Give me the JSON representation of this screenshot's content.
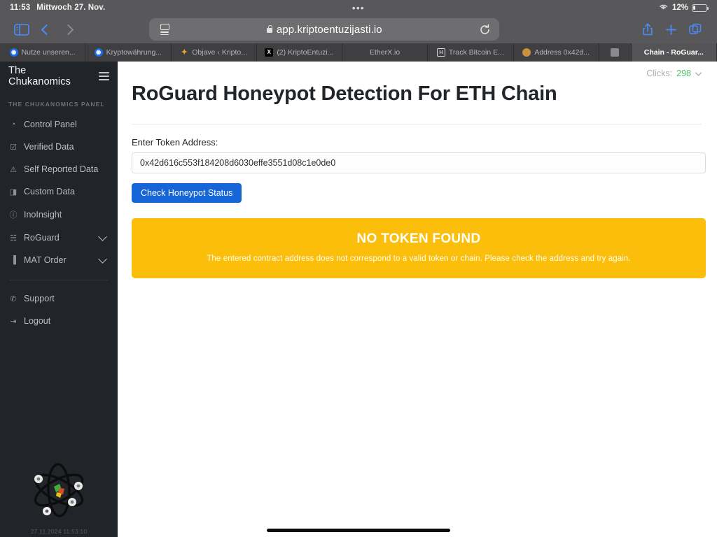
{
  "status_bar": {
    "time": "11:53",
    "date": "Mittwoch 27. Nov.",
    "dots": "•••",
    "battery_percent": "12%",
    "wifi_icon": "wifi-icon",
    "battery_icon": "battery-low-icon"
  },
  "browser": {
    "sidebar_icon": "sidebar-toggle-icon",
    "back_icon": "chevron-left-icon",
    "forward_icon": "chevron-right-icon",
    "reader_icon": "reader-view-icon",
    "lock_icon": "lock-icon",
    "url": "app.kriptoentuzijasti.io",
    "reload_icon": "reload-icon",
    "share_icon": "share-icon",
    "new_tab_icon": "plus-icon",
    "tabs_overview_icon": "tab-overview-icon",
    "tabs": [
      {
        "label": "Nutze unseren...",
        "favicon": "blue-circle-icon",
        "glyph": "◉",
        "active": false
      },
      {
        "label": "Kryptowährung...",
        "favicon": "blue-circle-icon",
        "glyph": "◉",
        "active": false
      },
      {
        "label": "Objave ‹ Kripto...",
        "favicon": "orange-spark-icon",
        "glyph": "✦",
        "active": false
      },
      {
        "label": "(2) KriptoEntuzi...",
        "favicon": "x-logo-icon",
        "glyph": "X",
        "active": false
      },
      {
        "label": "EtherX.io",
        "favicon": "blank-icon",
        "glyph": "",
        "active": false
      },
      {
        "label": "Track Bitcoin E...",
        "favicon": "h-badge-icon",
        "glyph": "H",
        "active": false
      },
      {
        "label": "Address 0x42d...",
        "favicon": "brown-circle-icon",
        "glyph": "",
        "active": false
      },
      {
        "label": "",
        "favicon": "small-square-icon",
        "glyph": "",
        "active": false,
        "narrow": true
      },
      {
        "label": "Chain - RoGuar...",
        "favicon": "blank-icon",
        "glyph": "",
        "active": true
      }
    ]
  },
  "app_header": {
    "brand": "The Chukanomics",
    "menu_icon": "hamburger-menu-icon",
    "clicks_label": "Clicks:",
    "clicks_value": "298",
    "clicks_caret_icon": "caret-down-icon"
  },
  "sidebar": {
    "section_title": "THE CHUKANOMICS PANEL",
    "items": [
      {
        "label": "Control Panel",
        "icon": "gauge-icon",
        "glyph": "◔",
        "chevron": false
      },
      {
        "label": "Verified Data",
        "icon": "check-square-icon",
        "glyph": "☑",
        "chevron": false
      },
      {
        "label": "Self Reported Data",
        "icon": "warning-triangle-icon",
        "glyph": "⚠",
        "chevron": false
      },
      {
        "label": "Custom Data",
        "icon": "edit-square-icon",
        "glyph": "◨",
        "chevron": false
      },
      {
        "label": "InoInsight",
        "icon": "info-circle-icon",
        "glyph": "ⓘ",
        "chevron": false
      },
      {
        "label": "RoGuard",
        "icon": "shield-users-icon",
        "glyph": "☵",
        "chevron": true
      },
      {
        "label": "MAT Order",
        "icon": "bar-chart-icon",
        "glyph": "▐",
        "chevron": true
      }
    ],
    "footer_items": [
      {
        "label": "Support",
        "icon": "headset-icon",
        "glyph": "✆"
      },
      {
        "label": "Logout",
        "icon": "logout-icon",
        "glyph": "⇥"
      }
    ],
    "logo_icon": "atom-logo-icon",
    "stamp": "27.11.2024 11:53:10"
  },
  "main": {
    "title": "RoGuard Honeypot Detection For ETH Chain",
    "field_label": "Enter Token Address:",
    "token_address": "0x42d616c553f184208d6030effe3551d08c1e0de0",
    "token_placeholder": "Enter Token Address",
    "submit_label": "Check Honeypot Status",
    "alert": {
      "title": "NO TOKEN FOUND",
      "text": "The entered contract address does not correspond to a valid token or chain. Please check the address and try again.",
      "color": "#fbbf0b"
    }
  },
  "colors": {
    "sidebar_bg": "#212529",
    "accent_blue": "#1565d8",
    "warning": "#fbbf0b",
    "clicks_green": "#53c26a"
  }
}
